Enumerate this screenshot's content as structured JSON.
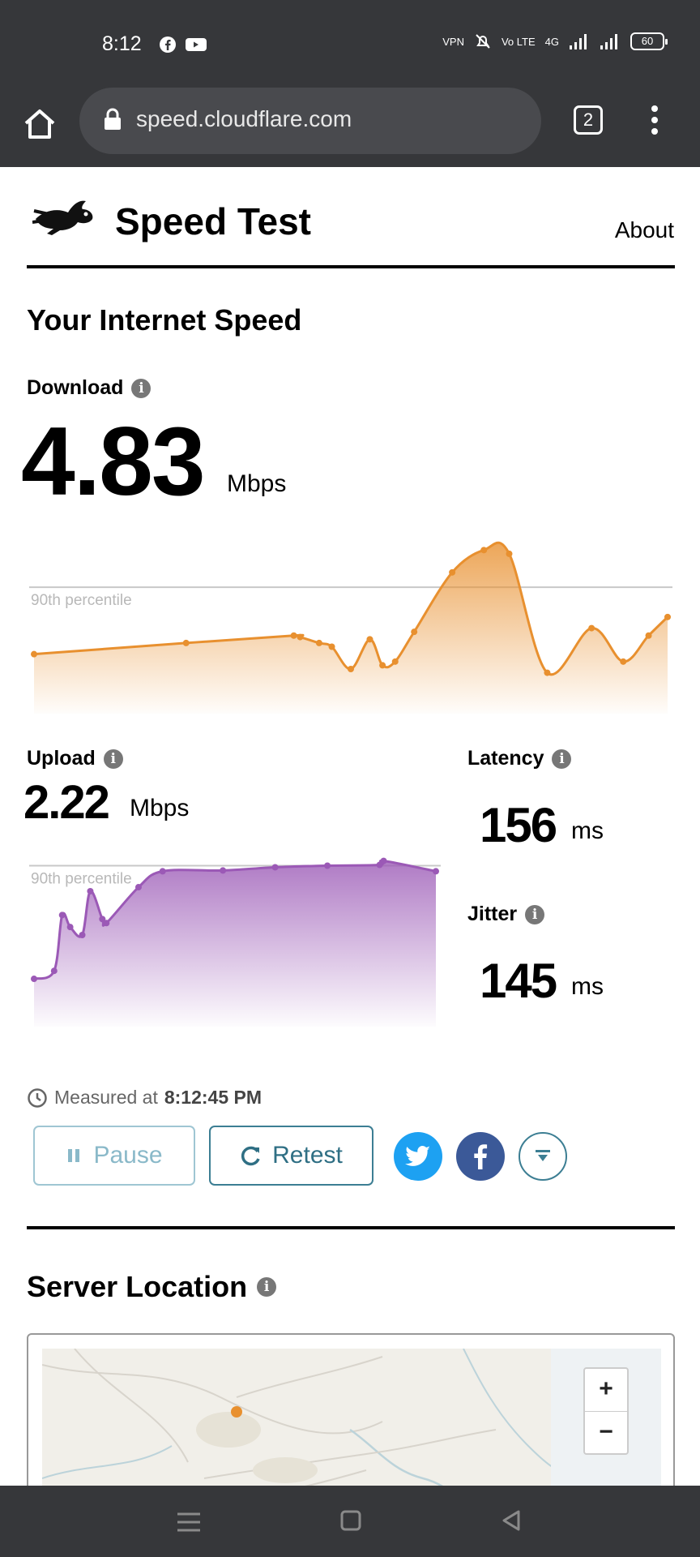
{
  "status_bar": {
    "time": "8:12",
    "app_icons": [
      "facebook-icon",
      "youtube-icon"
    ],
    "right_labels": [
      "VPN",
      "Vo LTE",
      "4G"
    ],
    "battery": "60"
  },
  "browser": {
    "url": "speed.cloudflare.com",
    "tab_count": "2"
  },
  "header": {
    "title": "Speed Test",
    "about": "About"
  },
  "main": {
    "heading": "Your Internet Speed",
    "download": {
      "label": "Download",
      "value": "4.83",
      "unit": "Mbps"
    },
    "upload": {
      "label": "Upload",
      "value": "2.22",
      "unit": "Mbps"
    },
    "latency": {
      "label": "Latency",
      "value": "156",
      "unit": "ms"
    },
    "jitter": {
      "label": "Jitter",
      "value": "145",
      "unit": "ms"
    },
    "percentile_label": "90th percentile",
    "measured_prefix": "Measured at",
    "measured_time": "8:12:45 PM",
    "pause_label": "Pause",
    "retest_label": "Retest"
  },
  "server": {
    "heading": "Server Location",
    "zoom_in": "+",
    "zoom_out": "−"
  },
  "colors": {
    "download": "#e8902f",
    "upload": "#9b59b6",
    "twitter": "#1da1f2",
    "facebook": "#3b5998",
    "accent": "#3c7e93"
  },
  "chart_data": [
    {
      "type": "area",
      "series": [
        {
          "values": [
            4.1,
            4.25,
            4.35,
            4.33,
            4.25,
            4.2,
            3.9,
            4.3,
            3.95,
            4.0,
            4.4,
            5.2,
            5.5,
            5.45,
            3.85,
            4.45,
            4.0,
            4.35,
            4.6
          ]
        }
      ],
      "x": [
        0,
        24,
        41,
        42,
        45,
        47,
        50,
        53,
        55,
        57,
        60,
        66,
        71,
        75,
        81,
        88,
        93,
        97,
        100
      ],
      "percentile_90": 5.0,
      "ylim": [
        3.3,
        5.7
      ]
    },
    {
      "type": "area",
      "series": [
        {
          "values": [
            0.8,
            0.9,
            1.6,
            1.45,
            1.35,
            1.9,
            1.55,
            1.5,
            1.95,
            2.15,
            2.16,
            2.2,
            2.22,
            2.23,
            2.28,
            2.15
          ]
        }
      ],
      "x": [
        0,
        5,
        7,
        9,
        12,
        14,
        17,
        18,
        26,
        32,
        47,
        60,
        73,
        86,
        87,
        100
      ],
      "percentile_90": 2.22,
      "ylim": [
        0.2,
        2.5
      ]
    }
  ]
}
